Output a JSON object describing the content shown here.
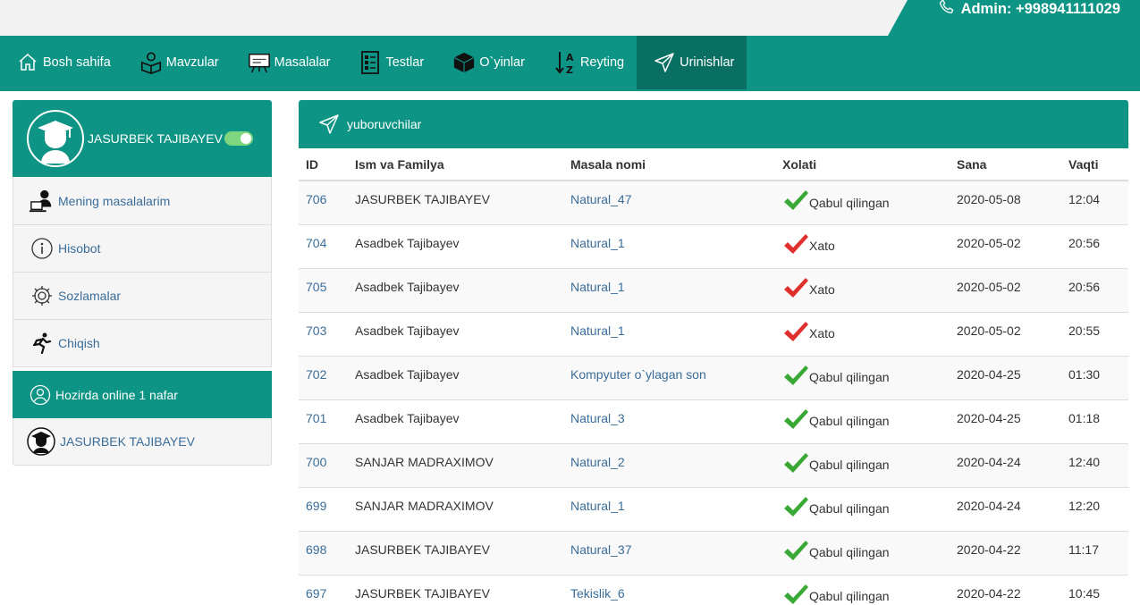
{
  "header": {
    "admin_text": "Admin: +998941111029"
  },
  "nav": [
    {
      "label": "Bosh sahifa",
      "icon": "home-icon"
    },
    {
      "label": "Mavzular",
      "icon": "book-reader-icon"
    },
    {
      "label": "Masalalar",
      "icon": "easel-icon"
    },
    {
      "label": "Testlar",
      "icon": "checklist-icon"
    },
    {
      "label": "O`yinlar",
      "icon": "cube-icon"
    },
    {
      "label": "Reyting",
      "icon": "sort-az-icon"
    },
    {
      "label": "Urinishlar",
      "icon": "send-icon"
    }
  ],
  "sidebar": {
    "user_name": "JASURBEK TAJIBAYEV",
    "items": [
      {
        "label": "Mening masalalarim",
        "icon": "user-laptop-icon"
      },
      {
        "label": "Hisobot",
        "icon": "info-icon"
      },
      {
        "label": "Sozlamalar",
        "icon": "gear-icon"
      },
      {
        "label": "Chiqish",
        "icon": "running-icon"
      }
    ],
    "online_title": "Hozirda online 1 nafar",
    "online_user": "JASURBEK TAJIBAYEV"
  },
  "panel": {
    "title": "yuboruvchilar",
    "columns": [
      "ID",
      "Ism va Familya",
      "Masala nomi",
      "Xolati",
      "Sana",
      "Vaqti"
    ],
    "rows": [
      {
        "id": "706",
        "name": "JASURBEK TAJIBAYEV",
        "problem": "Natural_47",
        "status": "Qabul qilingan",
        "ok": true,
        "date": "2020-05-08",
        "time": "12:04"
      },
      {
        "id": "704",
        "name": "Asadbek Tajibayev",
        "problem": "Natural_1",
        "status": "Xato",
        "ok": false,
        "date": "2020-05-02",
        "time": "20:56"
      },
      {
        "id": "705",
        "name": "Asadbek Tajibayev",
        "problem": "Natural_1",
        "status": "Xato",
        "ok": false,
        "date": "2020-05-02",
        "time": "20:56"
      },
      {
        "id": "703",
        "name": "Asadbek Tajibayev",
        "problem": "Natural_1",
        "status": "Xato",
        "ok": false,
        "date": "2020-05-02",
        "time": "20:55"
      },
      {
        "id": "702",
        "name": "Asadbek Tajibayev",
        "problem": "Kompyuter o`ylagan son",
        "status": "Qabul qilingan",
        "ok": true,
        "date": "2020-04-25",
        "time": "01:30"
      },
      {
        "id": "701",
        "name": "Asadbek Tajibayev",
        "problem": "Natural_3",
        "status": "Qabul qilingan",
        "ok": true,
        "date": "2020-04-25",
        "time": "01:18"
      },
      {
        "id": "700",
        "name": "SANJAR MADRAXIMOV",
        "problem": "Natural_2",
        "status": "Qabul qilingan",
        "ok": true,
        "date": "2020-04-24",
        "time": "12:40"
      },
      {
        "id": "699",
        "name": "SANJAR MADRAXIMOV",
        "problem": "Natural_1",
        "status": "Qabul qilingan",
        "ok": true,
        "date": "2020-04-24",
        "time": "12:20"
      },
      {
        "id": "698",
        "name": "JASURBEK TAJIBAYEV",
        "problem": "Natural_37",
        "status": "Qabul qilingan",
        "ok": true,
        "date": "2020-04-22",
        "time": "11:17"
      },
      {
        "id": "697",
        "name": "JASURBEK TAJIBAYEV",
        "problem": "Tekislik_6",
        "status": "Qabul qilingan",
        "ok": true,
        "date": "2020-04-22",
        "time": "10:45"
      }
    ]
  },
  "colors": {
    "brand": "#0e9485",
    "brand_dark": "#0a6f63",
    "link": "#3a6d9a",
    "ok": "#3aa835",
    "err": "#e0302d"
  }
}
